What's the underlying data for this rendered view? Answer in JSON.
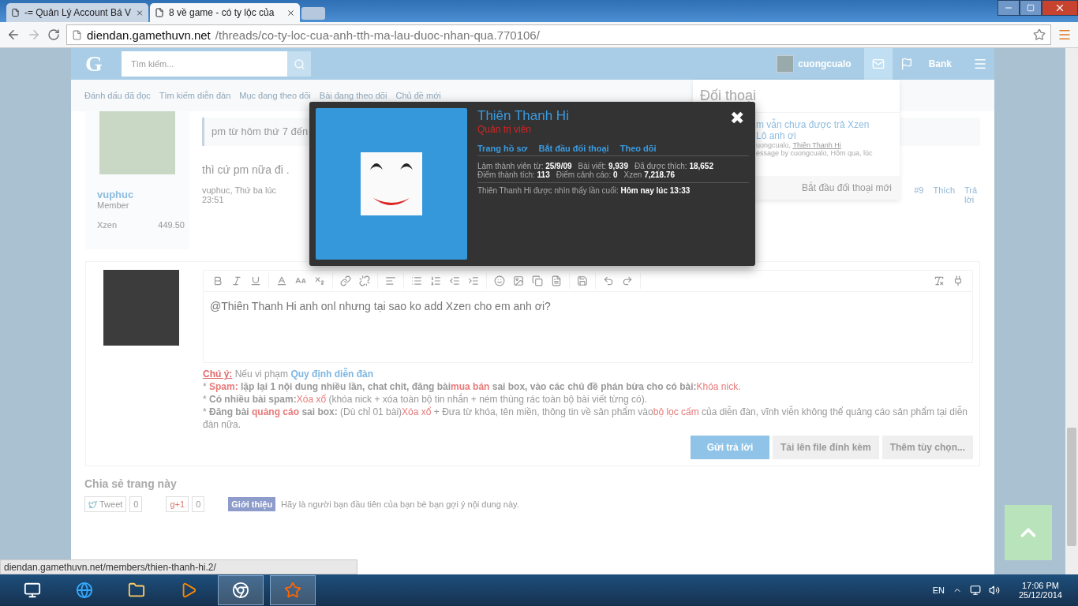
{
  "browser": {
    "tabs": [
      {
        "title": "-= Quản Lý Account Bá V",
        "selected": false
      },
      {
        "title": "8 về game - có ty lộc của",
        "selected": true
      }
    ],
    "url_host": "diendan.gamethuvn.net",
    "url_path": "/threads/co-ty-loc-cua-anh-tth-ma-lau-duoc-nhan-qua.770106/",
    "status_url": "diendan.gamethuvn.net/members/thien-thanh-hi.2/"
  },
  "site_header": {
    "logo": "G",
    "search_placeholder": "Tìm kiếm...",
    "username": "cuongcualo",
    "bank": "Bank"
  },
  "subnav": [
    "Đánh dấu đã đọc",
    "Tìm kiếm diễn đàn",
    "Mục đang theo dõi",
    "Bài đang theo dõi",
    "Chủ đề mới"
  ],
  "post": {
    "author": "vuphuc",
    "role": "Member",
    "stat_label": "Xzen",
    "stat_value": "449.50",
    "quote": "pm từ hôm thứ 7 đến",
    "message": "thì cứ pm nữa đi .",
    "meta": "vuphuc, Thứ ba lúc",
    "time": "23:51",
    "number": "#9",
    "like": "Thích",
    "reply": "Trả lời"
  },
  "conversations": {
    "title": "Đối thoại",
    "subject": "m vẫn chưa được trả Xzen",
    "subject_line2": "Lô anh ơi",
    "participants": "uongcualo,",
    "participant_link": "Thiên Thanh Hi",
    "meta": "essage by cuongcualo, Hôm qua, lúc",
    "start": "Bắt đầu đối thoại mới"
  },
  "popup": {
    "name": "Thiên Thanh Hi",
    "title": "Quản trị viên",
    "close": "✖",
    "links": [
      "Trang hồ sơ",
      "Bắt đầu đối thoại",
      "Theo dõi"
    ],
    "stat_rows": [
      [
        {
          "label": "Làm thành viên từ:",
          "value": "25/9/09"
        },
        {
          "label": "Bài viết:",
          "value": "9,939"
        },
        {
          "label": "Đã được thích:",
          "value": "18,652"
        }
      ],
      [
        {
          "label": "Điểm thành tích:",
          "value": "113"
        },
        {
          "label": "Điểm cảnh cáo:",
          "value": "0"
        },
        {
          "label": "Xzen",
          "value": "7,218.76"
        }
      ]
    ],
    "last_seen_label": "Thiên Thanh Hi được nhìn thấy lần cuối:",
    "last_seen": "Hôm nay lúc 13:33"
  },
  "editor": {
    "value": "@Thiên Thanh Hi  anh onl nhưng tại sao ko add Xzen cho em anh ơi?"
  },
  "rules": [
    [
      {
        "text": "Chú ý:",
        "kind": "warn"
      },
      {
        "text": " Nếu vi phạm ",
        "kind": "plain"
      },
      {
        "text": "Quy định diễn đàn",
        "kind": "link"
      }
    ],
    [
      {
        "text": "* ",
        "kind": "plain"
      },
      {
        "text": "Spam:",
        "kind": "redbold"
      },
      {
        "text": " lặp lại 1 nội dung nhiều lần, chat chit, đăng bài",
        "kind": "bold"
      },
      {
        "text": "mua bán",
        "kind": "redbold"
      },
      {
        "text": " sai box, vào các chủ đề phán bừa cho có bài:",
        "kind": "bold"
      },
      {
        "text": "Khóa nick.",
        "kind": "red"
      }
    ],
    [
      {
        "text": "* ",
        "kind": "plain"
      },
      {
        "text": "Có nhiều bài spam:",
        "kind": "bold"
      },
      {
        "text": "Xóa xổ",
        "kind": "red"
      },
      {
        "text": " (khóa nick + xóa toàn bộ tin nhắn + ném thùng rác toàn bộ bài viết từng có).",
        "kind": "plain"
      }
    ],
    [
      {
        "text": "* ",
        "kind": "plain"
      },
      {
        "text": "Đăng bài ",
        "kind": "bold"
      },
      {
        "text": "quảng cáo",
        "kind": "redbold"
      },
      {
        "text": " sai box:",
        "kind": "bold"
      },
      {
        "text": " (Dù chỉ 01 bài)",
        "kind": "plain"
      },
      {
        "text": "Xóa xổ",
        "kind": "red"
      },
      {
        "text": " + Đưa từ khóa, tên miền, thông tin về sản phẩm vào",
        "kind": "plain"
      },
      {
        "text": "bộ lọc cấm",
        "kind": "red"
      },
      {
        "text": " của diễn đàn, vĩnh viễn không thể quảng cáo sản phẩm tại diễn đàn nữa.",
        "kind": "plain"
      }
    ]
  ],
  "buttons": [
    {
      "label": "Gửi trả lời",
      "kind": "primary"
    },
    {
      "label": "Tải lên file đính kèm",
      "kind": "secondary"
    },
    {
      "label": "Thêm tùy chọn...",
      "kind": "secondary"
    }
  ],
  "share": {
    "title": "Chia sẻ trang này",
    "tweet": "Tweet",
    "tweet_count": "0",
    "gplus": "g+1",
    "gplus_count": "0",
    "fb": "Giới thiệu",
    "fb_text": "Hãy là người bạn đầu tiên của bạn bè bạn gợi ý nội dung này."
  },
  "taskbar": {
    "lang": "EN",
    "time": "17:06 PM",
    "date": "25/12/2014"
  }
}
